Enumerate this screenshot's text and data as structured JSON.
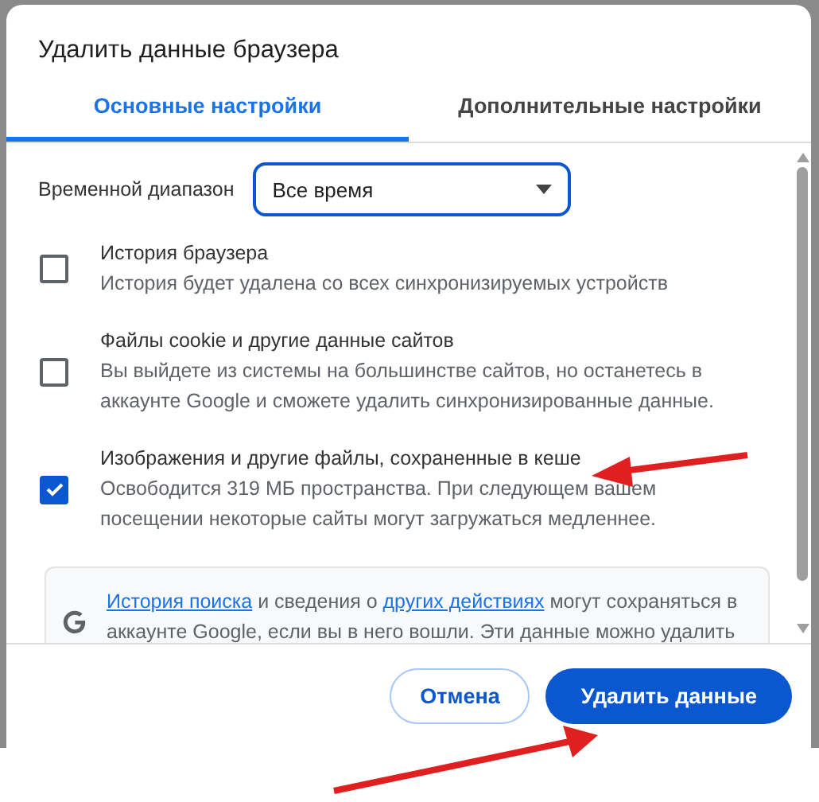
{
  "dialog": {
    "title": "Удалить данные браузера",
    "tabs": [
      {
        "label": "Основные настройки",
        "selected": true
      },
      {
        "label": "Дополнительные настройки",
        "selected": false
      }
    ],
    "time_range": {
      "label": "Временной диапазон",
      "value": "Все время"
    },
    "items": [
      {
        "title": "История браузера",
        "description": "История будет удалена со всех синхронизируемых устройств",
        "checked": false
      },
      {
        "title": "Файлы cookie и другие данные сайтов",
        "description": "Вы выйдете из системы на большинстве сайтов, но останетесь в аккаунте Google и сможете удалить синхронизированные данные.",
        "checked": false
      },
      {
        "title": "Изображения и другие файлы, сохраненные в кеше",
        "description": "Освободится 319 МБ пространства. При следующем вашем посещении некоторые сайты могут загружаться медленнее.",
        "checked": true
      }
    ],
    "info": {
      "parts": [
        {
          "kind": "link",
          "text": "История поиска"
        },
        {
          "kind": "text",
          "text": " и сведения о "
        },
        {
          "kind": "link",
          "text": "других действиях"
        },
        {
          "kind": "text",
          "text": " могут сохраняться в аккаунте Google, если вы в него вошли. Эти данные можно удалить"
        }
      ]
    },
    "buttons": [
      {
        "label": "Отмена",
        "kind": "secondary"
      },
      {
        "label": "Удалить данные",
        "kind": "primary"
      }
    ]
  },
  "annotations": [
    {
      "kind": "arrow"
    },
    {
      "kind": "arrow"
    }
  ]
}
